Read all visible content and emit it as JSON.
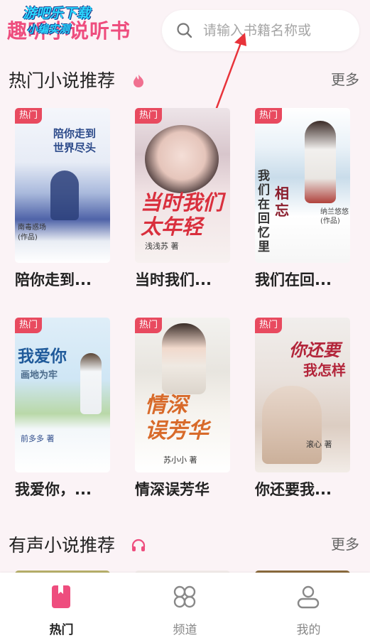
{
  "header": {
    "app_title": "趣听小说听书",
    "watermark_line1": "游吧乐下载",
    "watermark_line2": "小编实测"
  },
  "search": {
    "placeholder": "请输入书籍名称或"
  },
  "sections": [
    {
      "title": "热门小说推荐",
      "more": "更多",
      "badge_icon": "flame-icon"
    },
    {
      "title": "有声小说推荐",
      "more": "更多",
      "badge_icon": "headphones-icon"
    }
  ],
  "hot_tag": "热门",
  "books": [
    {
      "name": "陪你走到...",
      "cover_title": "陪你走到世界尽头",
      "cover_author": "南毒惑场 (作品)"
    },
    {
      "name": "当时我们...",
      "cover_title": "当时我们太年轻",
      "cover_author": "浅浅苏 著"
    },
    {
      "name": "我们在回...",
      "cover_title": "我们在回忆里相忘",
      "cover_author": "纳兰悠悠 (作品)"
    },
    {
      "name": "我爱你，...",
      "cover_title": "我爱你画地为牢",
      "cover_author": "前多多 著"
    },
    {
      "name": "情深误芳华",
      "cover_title": "情深误芳华",
      "cover_author": "苏小小 著"
    },
    {
      "name": "你还要我...",
      "cover_title": "你还要我怎样",
      "cover_author": "滚心 著"
    }
  ],
  "tabbar": [
    {
      "label": "热门",
      "icon": "bookmark-icon",
      "active": true
    },
    {
      "label": "频道",
      "icon": "grid-icon",
      "active": false
    },
    {
      "label": "我的",
      "icon": "user-icon",
      "active": false
    }
  ],
  "colors": {
    "accent": "#ee4d7e",
    "hot_tag": "#e84a5f",
    "background": "#fbf3f6"
  }
}
